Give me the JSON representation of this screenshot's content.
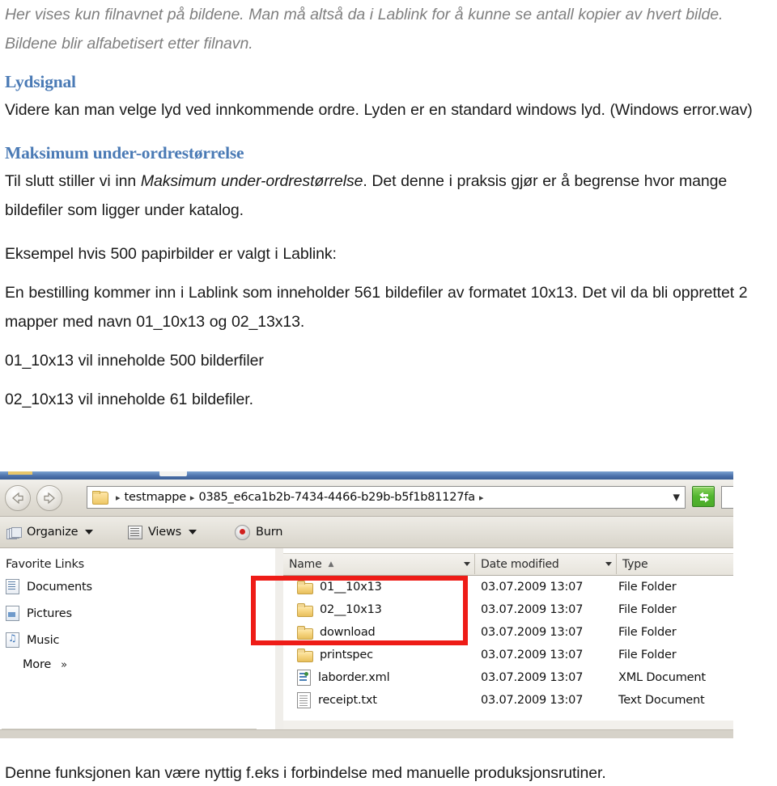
{
  "document": {
    "intro_paragraph": "Her vises kun filnavnet på bildene. Man må altså da i Lablink for å kunne se antall kopier av hvert bilde. Bildene blir alfabetisert etter filnavn.",
    "sections": [
      {
        "heading": "Lydsignal",
        "body": "Videre kan man velge lyd ved innkommende ordre. Lyden er en standard windows lyd. (Windows error.wav)"
      },
      {
        "heading": "Maksimum under-ordrestørrelse",
        "body_lead": "Til slutt stiller vi inn ",
        "body_italic": "Maksimum under-ordrestørrelse",
        "body_tail": ". Det denne i praksis gjør er å begrense hvor mange bildefiler som ligger under katalog."
      }
    ],
    "example_intro": "Eksempel hvis 500 papirbilder er valgt i Lablink:",
    "example_body": "En bestilling kommer inn i Lablink som inneholder 561 bildefiler av formatet 10x13. Det vil da bli opprettet 2 mapper med navn 01_10x13 og 02_13x13.",
    "example_line_1": "01_10x13 vil inneholde 500 bilderfiler",
    "example_line_2": "02_10x13 vil inneholde 61 bildefiler.",
    "footer_note": "Denne funksjonen kan være nyttig f.eks i forbindelse med manuelle produksjonsrutiner.",
    "heading_color": "#4a7ab5",
    "intro_color": "#7f7f7f",
    "annotation_color": "#ee1c17"
  },
  "explorer": {
    "navigation": {
      "back_icon": "back-arrow-icon",
      "forward_icon": "forward-arrow-icon",
      "breadcrumb": [
        "testmappe",
        "0385_e6ca1b2b-7434-4466-b29b-b5f1b81127fa"
      ],
      "address_dropdown_icon": "chevron-down-icon",
      "refresh_icon": "refresh-icon"
    },
    "toolbar": {
      "organize_label": "Organize",
      "views_label": "Views",
      "burn_label": "Burn"
    },
    "favorites": {
      "title": "Favorite Links",
      "items": [
        {
          "label": "Documents",
          "icon": "documents-icon"
        },
        {
          "label": "Pictures",
          "icon": "pictures-icon"
        },
        {
          "label": "Music",
          "icon": "music-icon"
        }
      ],
      "more_label": "More",
      "more_chevrons": "»"
    },
    "file_list": {
      "columns": [
        "Name",
        "Date modified",
        "Type"
      ],
      "sort_indicator": "▲",
      "rows": [
        {
          "name": "01__10x13",
          "date": "03.07.2009 13:07",
          "type": "File Folder",
          "icon": "folder-icon"
        },
        {
          "name": "02__10x13",
          "date": "03.07.2009 13:07",
          "type": "File Folder",
          "icon": "folder-icon"
        },
        {
          "name": "download",
          "date": "03.07.2009 13:07",
          "type": "File Folder",
          "icon": "folder-icon"
        },
        {
          "name": "printspec",
          "date": "03.07.2009 13:07",
          "type": "File Folder",
          "icon": "folder-icon"
        },
        {
          "name": "laborder.xml",
          "date": "03.07.2009 13:07",
          "type": "XML Document",
          "icon": "xml-file-icon"
        },
        {
          "name": "receipt.txt",
          "date": "03.07.2009 13:07",
          "type": "Text Document",
          "icon": "text-file-icon"
        }
      ]
    }
  }
}
